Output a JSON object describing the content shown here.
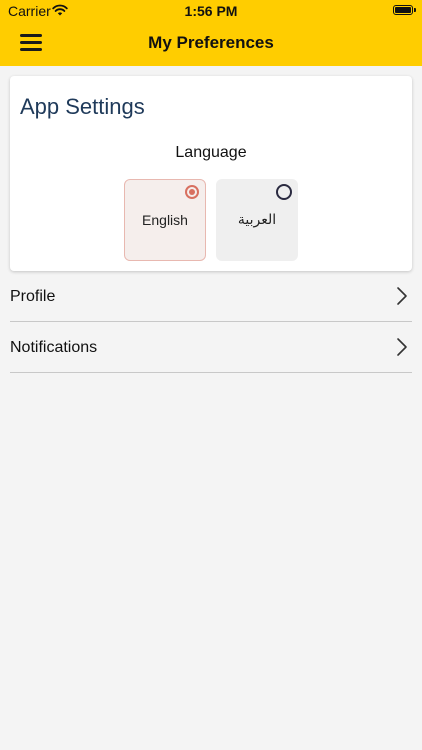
{
  "status_bar": {
    "carrier": "Carrier",
    "time": "1:56 PM"
  },
  "header": {
    "title": "My Preferences",
    "background_color": "#ffcd00"
  },
  "app_settings": {
    "title": "App Settings",
    "language_label": "Language",
    "languages": [
      {
        "label": "English",
        "selected": true
      },
      {
        "label": "العربية",
        "selected": false
      }
    ],
    "accent_color": "#d87060"
  },
  "menu": {
    "items": [
      {
        "label": "Profile",
        "icon": "chevron-right-icon"
      },
      {
        "label": "Notifications",
        "icon": "chevron-right-icon"
      }
    ]
  }
}
